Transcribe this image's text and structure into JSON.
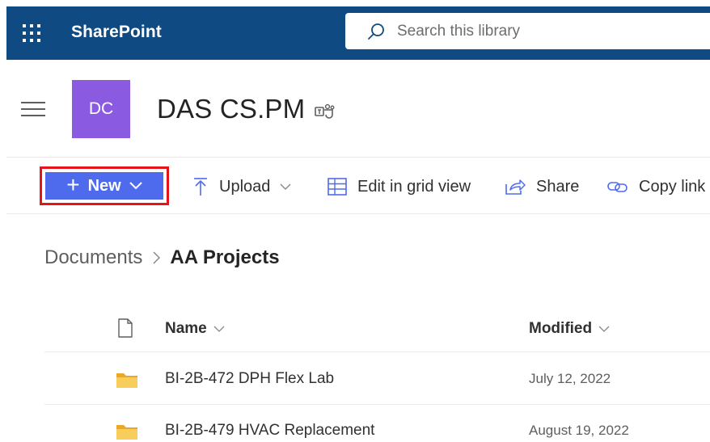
{
  "suite_bar": {
    "app_name": "SharePoint",
    "search_placeholder": "Search this library",
    "background_color": "#0f4a83"
  },
  "site": {
    "logo_initials": "DC",
    "logo_color": "#8a5be0",
    "title": "DAS CS.PM"
  },
  "command_bar": {
    "new_label": "New",
    "upload_label": "Upload",
    "grid_label": "Edit in grid view",
    "share_label": "Share",
    "copy_link_label": "Copy link",
    "new_button_color": "#4f6bed",
    "highlight_color": "#e5131b"
  },
  "breadcrumb": {
    "root": "Documents",
    "current": "AA Projects"
  },
  "list": {
    "columns": {
      "name": "Name",
      "modified": "Modified"
    },
    "rows": [
      {
        "name": "BI-2B-472 DPH Flex Lab",
        "modified": "July 12, 2022",
        "icon": "folder-icon"
      },
      {
        "name": "BI-2B-479 HVAC Replacement",
        "modified": "August 19, 2022",
        "icon": "folder-icon"
      }
    ]
  }
}
